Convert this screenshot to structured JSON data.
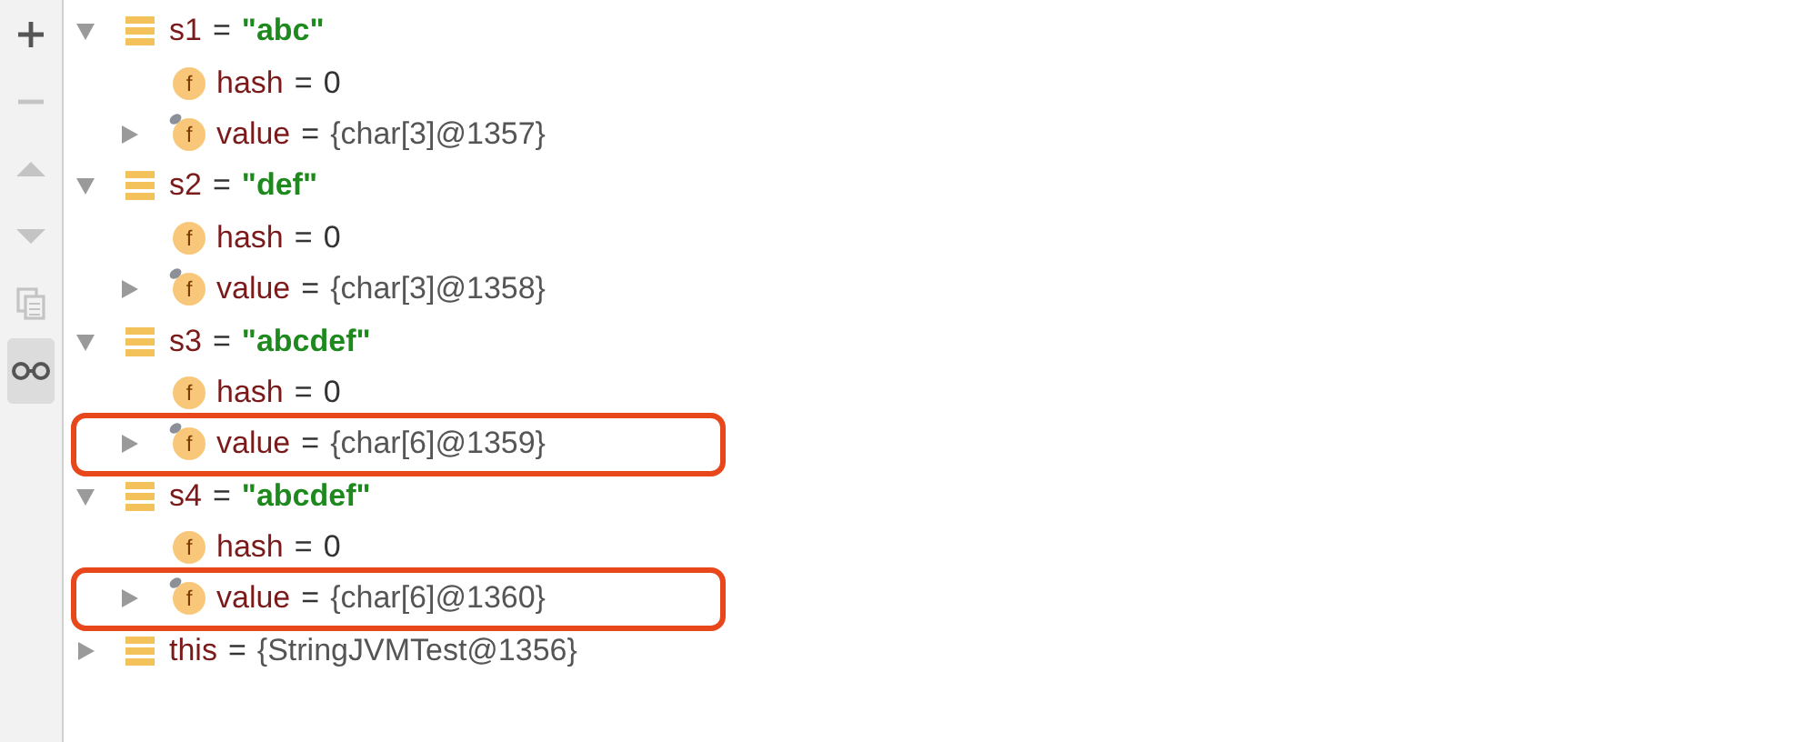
{
  "toolbar": [
    {
      "kind": "add",
      "disabled": false,
      "selected": false
    },
    {
      "kind": "remove",
      "disabled": true,
      "selected": false
    },
    {
      "kind": "up",
      "disabled": true,
      "selected": false
    },
    {
      "kind": "down",
      "disabled": true,
      "selected": false
    },
    {
      "kind": "copy",
      "disabled": true,
      "selected": false
    },
    {
      "kind": "watch",
      "disabled": false,
      "selected": true
    }
  ],
  "variables": [
    {
      "kind": "variable",
      "name": "s1",
      "operator": "=",
      "value": "\"abc\"",
      "quoted": true,
      "expanded": true,
      "children": [
        {
          "kind": "field",
          "badge": "f",
          "overlay": false,
          "name": "hash",
          "operator": "=",
          "value": "0",
          "quoted": false,
          "highlighted": false
        },
        {
          "kind": "field",
          "badge": "f",
          "overlay": true,
          "name": "value",
          "operator": "=",
          "value": "{char[3]@1357}",
          "quoted": false,
          "expanded": false,
          "highlighted": false
        }
      ]
    },
    {
      "kind": "variable",
      "name": "s2",
      "operator": "=",
      "value": "\"def\"",
      "quoted": true,
      "expanded": true,
      "children": [
        {
          "kind": "field",
          "badge": "f",
          "overlay": false,
          "name": "hash",
          "operator": "=",
          "value": "0",
          "quoted": false,
          "highlighted": false
        },
        {
          "kind": "field",
          "badge": "f",
          "overlay": true,
          "name": "value",
          "operator": "=",
          "value": "{char[3]@1358}",
          "quoted": false,
          "expanded": false,
          "highlighted": false
        }
      ]
    },
    {
      "kind": "variable",
      "name": "s3",
      "operator": "=",
      "value": "\"abcdef\"",
      "quoted": true,
      "expanded": true,
      "children": [
        {
          "kind": "field",
          "badge": "f",
          "overlay": false,
          "name": "hash",
          "operator": "=",
          "value": "0",
          "quoted": false,
          "highlighted": false
        },
        {
          "kind": "field",
          "badge": "f",
          "overlay": true,
          "name": "value",
          "operator": "=",
          "value": "{char[6]@1359}",
          "quoted": false,
          "expanded": false,
          "highlighted": true
        }
      ]
    },
    {
      "kind": "variable",
      "name": "s4",
      "operator": "=",
      "value": "\"abcdef\"",
      "quoted": true,
      "expanded": true,
      "children": [
        {
          "kind": "field",
          "badge": "f",
          "overlay": false,
          "name": "hash",
          "operator": "=",
          "value": "0",
          "quoted": false,
          "highlighted": false
        },
        {
          "kind": "field",
          "badge": "f",
          "overlay": true,
          "name": "value",
          "operator": "=",
          "value": "{char[6]@1360}",
          "quoted": false,
          "expanded": false,
          "highlighted": true
        }
      ]
    },
    {
      "kind": "variable",
      "name": "this",
      "operator": "=",
      "value": "{StringJVMTest@1356}",
      "quoted": false,
      "expanded": false
    }
  ]
}
